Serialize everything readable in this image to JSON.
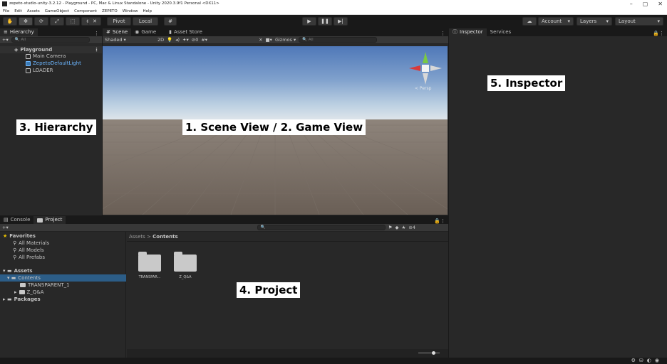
{
  "window": {
    "title": "zepeto-studio-unity-3.2.12 - Playground - PC, Mac & Linux Standalone - Unity 2020.3.9f1 Personal <DX11>",
    "controls": [
      "–",
      "▢",
      "✕"
    ]
  },
  "menu": [
    "File",
    "Edit",
    "Assets",
    "GameObject",
    "Component",
    "ZEPETO",
    "Window",
    "Help"
  ],
  "toolbar": {
    "tools": [
      "hand-tool",
      "move-tool",
      "rotate-tool",
      "scale-tool",
      "rect-tool",
      "transform-tool",
      "custom-tool"
    ],
    "pivot_label": "Pivot",
    "local_label": "Local",
    "account_label": "Account",
    "layers_label": "Layers",
    "layout_label": "Layout"
  },
  "hierarchy": {
    "tab_label": "Hierarchy",
    "search_placeholder": "All",
    "scene_name": "Playground",
    "items": [
      "Main Camera",
      "ZepetoDefaultLight",
      "LOADER"
    ]
  },
  "scene_view": {
    "tabs": [
      "Scene",
      "Game",
      "Asset Store"
    ],
    "shading_mode": "Shaded",
    "mode_2d": "2D",
    "gizmos_label": "Gizmos",
    "hidden_count": "0",
    "search_placeholder": "All",
    "persp_label": "< Persp"
  },
  "inspector": {
    "tabs": [
      "Inspector",
      "Services"
    ]
  },
  "bottom": {
    "tabs": [
      "Console",
      "Project"
    ],
    "hidden_count": "4",
    "tree": {
      "favorites_label": "Favorites",
      "favorites": [
        "All Materials",
        "All Models",
        "All Prefabs"
      ],
      "assets_label": "Assets",
      "contents_label": "Contents",
      "contents_children": [
        "TRANSPARENT_1",
        "Z_Q&A"
      ],
      "packages_label": "Packages"
    },
    "breadcrumb": {
      "root": "Assets",
      "separator": ">",
      "current": "Contents"
    },
    "files": [
      "TRANSPAR...",
      "Z_Q&A"
    ]
  },
  "annotations": {
    "scene_game": "1. Scene View / 2. Game View",
    "hierarchy": "3. Hierarchy",
    "project": "4. Project",
    "inspector": "5. Inspector"
  },
  "colors": {
    "selection": "#2c5d87",
    "panel": "#282828",
    "background": "#191919"
  }
}
